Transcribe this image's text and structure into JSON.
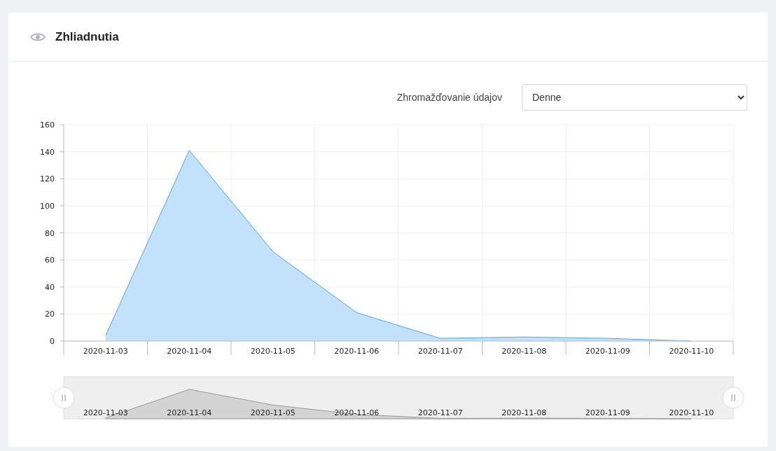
{
  "panel": {
    "title": "Zhliadnutia"
  },
  "aggregation": {
    "label": "Zhromažďovanie údajov",
    "value": "Denne"
  },
  "chart_data": {
    "type": "area",
    "categories": [
      "2020-11-03",
      "2020-11-04",
      "2020-11-05",
      "2020-11-06",
      "2020-11-07",
      "2020-11-08",
      "2020-11-09",
      "2020-11-10"
    ],
    "series": [
      {
        "color": "#4aa8f0",
        "values": [
          4,
          141,
          66,
          21,
          2,
          3,
          2,
          0
        ]
      }
    ],
    "grid": true,
    "ylim": [
      0,
      160
    ],
    "yticks": [
      0,
      20,
      40,
      60,
      80,
      100,
      120,
      140,
      160
    ]
  },
  "navigator": {
    "labels": [
      "2020-11-03",
      "2020-11-04",
      "2020-11-05",
      "2020-11-06",
      "2020-11-07",
      "2020-11-08",
      "2020-11-09",
      "2020-11-10"
    ]
  }
}
